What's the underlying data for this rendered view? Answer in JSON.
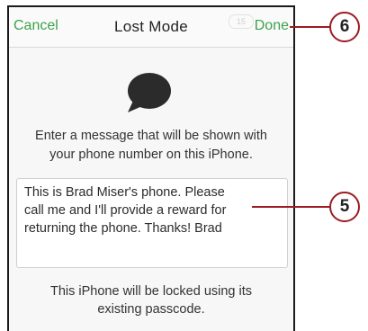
{
  "navbar": {
    "cancel_label": "Cancel",
    "title": "Lost Mode",
    "done_label": "Done"
  },
  "instruction": {
    "line1": "Enter a message that will be shown with",
    "line2": "your phone number on this iPhone."
  },
  "message": {
    "line1": "This is Brad Miser's phone. Please",
    "line2": "call me and I'll provide a reward for",
    "line3": "returning the phone. Thanks! Brad"
  },
  "footer": {
    "line1": "This iPhone will be locked using its",
    "line2": "existing passcode."
  },
  "watermark_text": "15",
  "callouts": [
    {
      "number": "6"
    },
    {
      "number": "5"
    }
  ],
  "colors": {
    "accent": "#3ca24b",
    "callout": "#9b1c22",
    "bubble": "#2b2b2b"
  },
  "icons": {
    "message_icon": "speech-bubble-icon"
  }
}
